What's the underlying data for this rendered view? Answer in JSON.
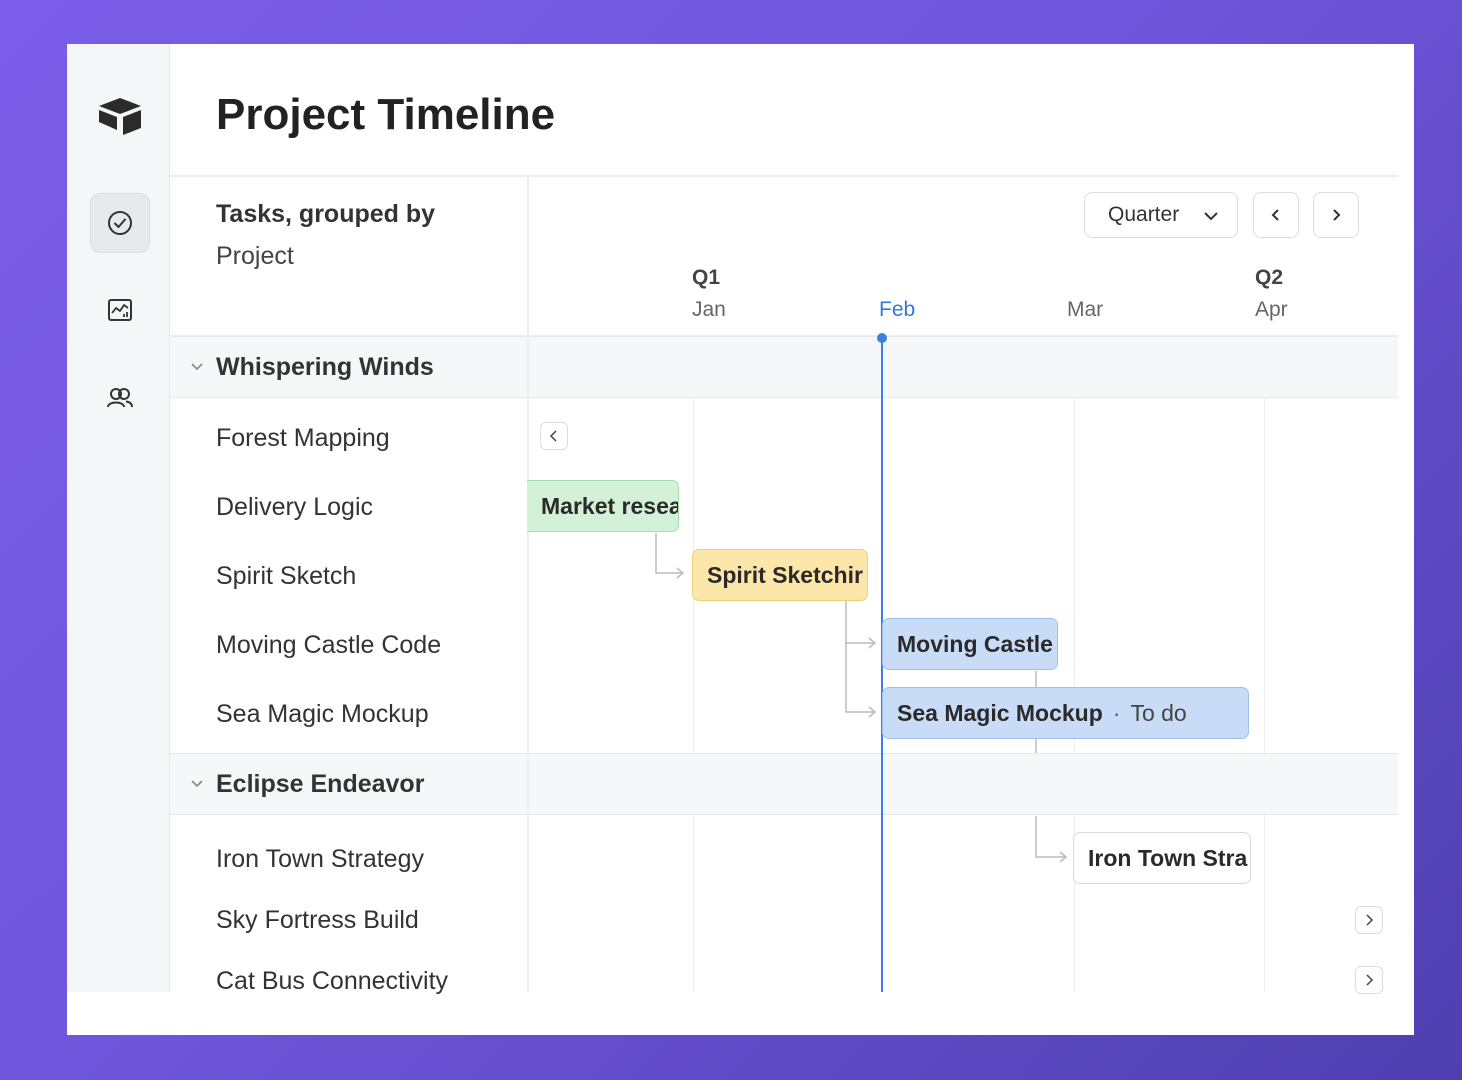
{
  "page": {
    "title": "Project Timeline"
  },
  "sidebar": {
    "logo": "airtable-logo-icon",
    "items": [
      {
        "icon": "check-circle-icon",
        "active": true
      },
      {
        "icon": "chart-icon",
        "active": false
      },
      {
        "icon": "users-icon",
        "active": false
      }
    ]
  },
  "grouping": {
    "title": "Tasks, grouped by",
    "field": "Project"
  },
  "toolbar": {
    "range_select": "Quarter"
  },
  "timeline_axis": {
    "quarters": [
      "Q1",
      "Q2"
    ],
    "months": [
      "Jan",
      "Feb",
      "Mar",
      "Apr"
    ],
    "current_month": "Feb"
  },
  "groups": [
    {
      "name": "Whispering Winds",
      "tasks": [
        "Forest Mapping",
        "Delivery Logic",
        "Spirit Sketch",
        "Moving Castle Code",
        "Sea Magic Mockup"
      ]
    },
    {
      "name": "Eclipse Endeavor",
      "tasks": [
        "Iron Town Strategy",
        "Sky Fortress Build",
        "Cat Bus Connectivity"
      ]
    }
  ],
  "bars": {
    "market": {
      "label": "Market resea"
    },
    "spirit": {
      "label": "Spirit Sketchir"
    },
    "castle": {
      "label": "Moving Castle"
    },
    "seamagic": {
      "label": "Sea Magic Mockup",
      "status": "To do"
    },
    "irontown": {
      "label": "Iron Town Stra"
    }
  },
  "colors": {
    "today": "#3b82e0",
    "green_bar": "#d3f1d6",
    "yellow_bar": "#fde6a9",
    "blue_bar": "#c9dcf7"
  }
}
